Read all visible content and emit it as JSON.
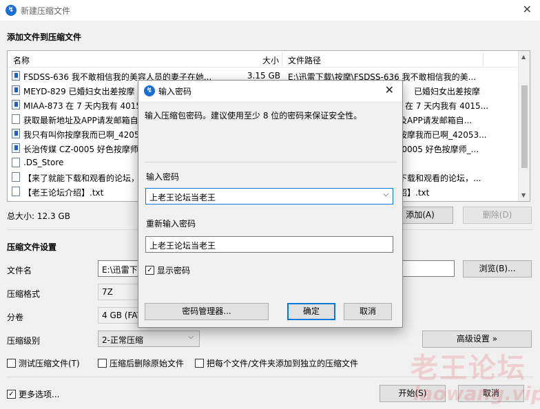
{
  "window": {
    "title": "新建压缩文件"
  },
  "add_section": {
    "title": "添加文件到压缩文件"
  },
  "filelist": {
    "columns": {
      "name": "名称",
      "size": "大小",
      "path": "文件路径"
    },
    "rows": [
      {
        "name": "FSDSS-636 我不敢相信我的美容人员的妻子在她...",
        "size": "3.15 GB",
        "path": "E:\\迅雷下载\\按摩\\FSDSS-636 我不敢相信我的美..."
      },
      {
        "name": "MEYD-829 已婚妇女出差按摩",
        "size": "",
        "path": "已婚妇女出差按摩"
      },
      {
        "name": "MIAA-873 在 7 天内我有 4015",
        "size": "",
        "path": "在 7 天内我有 4015..."
      },
      {
        "name": "获取最新地址及APP请发邮箱自",
        "size": "",
        "path": "及APP请发邮箱自..."
      },
      {
        "name": "我只有叫你按摩我而已啊_42050",
        "size": "",
        "path": "按摩我而已啊_42053..."
      },
      {
        "name": "长治传媒 CZ-0005 好色按摩师",
        "size": "",
        "path": "-0005 好色按摩师_..."
      },
      {
        "name": ".DS_Store",
        "size": "",
        "path": ""
      },
      {
        "name": "【来了就能下载和观看的论坛，",
        "size": "",
        "path": "下载和观看的论坛，..."
      },
      {
        "name": "【老王论坛介绍】.txt",
        "size": "",
        "path": "绍】.txt"
      }
    ]
  },
  "total_size": "总大小: 12.3 GB",
  "buttons": {
    "add": "添加(A)",
    "delete": "删除(D)",
    "browse": "浏览(B)...",
    "advanced": "高级设置 »",
    "start": "开始(S)",
    "cancel": "取消"
  },
  "settings": {
    "title": "压缩文件设置",
    "filename_label": "文件名",
    "filename_value": "E:\\迅雷下载",
    "format_label": "压缩格式",
    "format_value": "7Z",
    "split_label": "分卷",
    "split_value": "4 GB (FAT",
    "level_label": "压缩级别",
    "level_value": "2-正常压缩"
  },
  "checkboxes": {
    "test": "测试压缩文件(T)",
    "delete_after": "压缩后删除原始文件",
    "each_separate": "把每个文件/文件夹添加到独立的压缩文件",
    "more_options": "更多选项..."
  },
  "dialog": {
    "title": "输入密码",
    "description": "输入压缩包密码。建议使用至少 8 位的密码来保证安全性。",
    "password_label": "输入密码",
    "password_value": "上老王论坛当老王",
    "repeat_label": "重新输入密码",
    "repeat_value": "上老王论坛当老王",
    "show_password": "显示密码",
    "manager": "密码管理器...",
    "ok": "确定",
    "cancel": "取消"
  },
  "watermark": {
    "line1": "老王论坛",
    "line2": "laowang.vip"
  },
  "colors": {
    "accent": "#0078d7",
    "app_icon": "#1a6fd1"
  }
}
